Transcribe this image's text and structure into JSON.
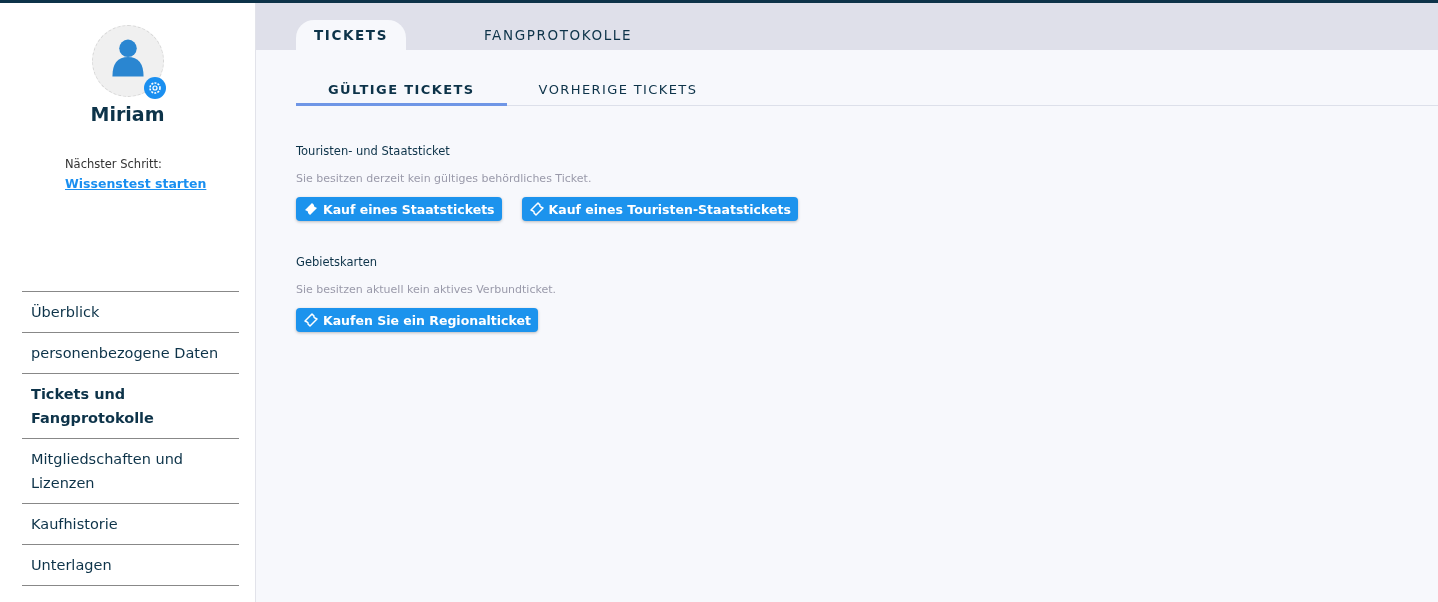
{
  "profile": {
    "name": "Miriam",
    "next_step_label": "Nächster Schritt:",
    "next_step_link": "Wissenstest starten"
  },
  "nav": [
    {
      "label": "Überblick",
      "selected": false
    },
    {
      "label": "personenbezogene Daten",
      "selected": false
    },
    {
      "label": "Tickets und Fangprotokolle",
      "selected": true
    },
    {
      "label": "Mitgliedschaften und Lizenzen",
      "selected": false
    },
    {
      "label": "Kaufhistorie",
      "selected": false
    },
    {
      "label": "Unterlagen",
      "selected": false
    }
  ],
  "tabs": [
    {
      "label": "TICKETS",
      "selected": true
    },
    {
      "label": "FANGPROTOKOLLE",
      "selected": false
    }
  ],
  "subtabs": [
    {
      "label": "GÜLTIGE TICKETS",
      "selected": true
    },
    {
      "label": "VORHERIGE TICKETS",
      "selected": false
    }
  ],
  "sections": [
    {
      "title": "Touristen- und Staatsticket",
      "message": "Sie besitzen derzeit kein gültiges behördliches Ticket.",
      "buttons": [
        {
          "label": "Kauf eines Staatstickets",
          "kind": "filled"
        },
        {
          "label": "Kauf eines Touristen-Staatstickets",
          "kind": "outline"
        }
      ]
    },
    {
      "title": "Gebietskarten",
      "message": "Sie besitzen aktuell kein aktives Verbundticket.",
      "buttons": [
        {
          "label": "Kaufen Sie ein Regionalticket",
          "kind": "outline"
        }
      ]
    }
  ]
}
